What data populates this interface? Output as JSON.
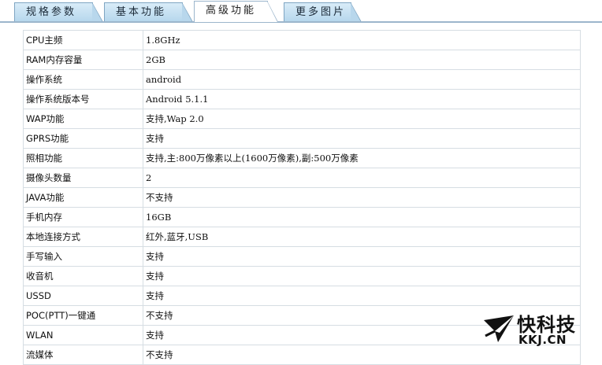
{
  "tabs": [
    {
      "label": "规格参数",
      "active": false
    },
    {
      "label": "基本功能",
      "active": false
    },
    {
      "label": "高级功能",
      "active": true
    },
    {
      "label": "更多图片",
      "active": false
    }
  ],
  "specs": [
    {
      "key": "CPU主频",
      "value": "1.8GHz"
    },
    {
      "key": "RAM内存容量",
      "value": "2GB"
    },
    {
      "key": "操作系统",
      "value": "android"
    },
    {
      "key": "操作系统版本号",
      "value": "Android 5.1.1"
    },
    {
      "key": "WAP功能",
      "value": "支持,Wap 2.0"
    },
    {
      "key": "GPRS功能",
      "value": "支持"
    },
    {
      "key": "照相功能",
      "value": "支持,主:800万像素以上(1600万像素),副:500万像素"
    },
    {
      "key": "摄像头数量",
      "value": "2"
    },
    {
      "key": "JAVA功能",
      "value": "不支持"
    },
    {
      "key": "手机内存",
      "value": "16GB"
    },
    {
      "key": "本地连接方式",
      "value": "红外,蓝牙,USB"
    },
    {
      "key": "手写输入",
      "value": "支持"
    },
    {
      "key": "收音机",
      "value": "支持"
    },
    {
      "key": "USSD",
      "value": "支持"
    },
    {
      "key": "POC(PTT)一键通",
      "value": "不支持"
    },
    {
      "key": "WLAN",
      "value": "支持"
    },
    {
      "key": "流媒体",
      "value": "不支持"
    }
  ],
  "watermark": {
    "brand": "快科技",
    "url": "KKJ.CN"
  }
}
